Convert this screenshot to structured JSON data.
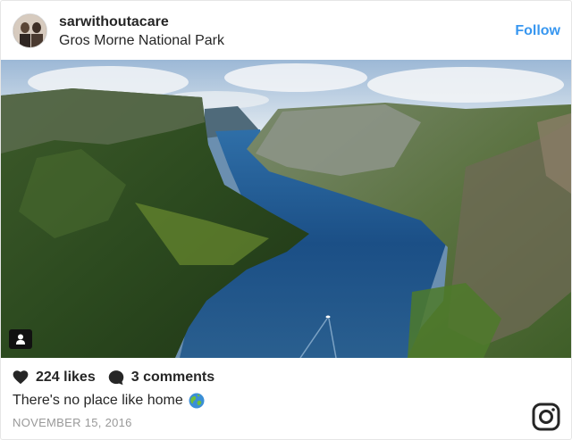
{
  "post": {
    "username": "sarwithoutacare",
    "location": "Gros Morne National Park",
    "follow_label": "Follow",
    "likes": "224 likes",
    "comments": "3 comments",
    "caption": "There's no place like home",
    "caption_emoji": "globe-emoji",
    "date": "NOVEMBER 15, 2016"
  },
  "icons": {
    "tag": "user-tag-icon",
    "like": "heart-icon",
    "comment": "comment-bubble-icon",
    "brand": "instagram-icon"
  },
  "colors": {
    "accent": "#3897f0",
    "text": "#262626",
    "muted": "#999999"
  }
}
